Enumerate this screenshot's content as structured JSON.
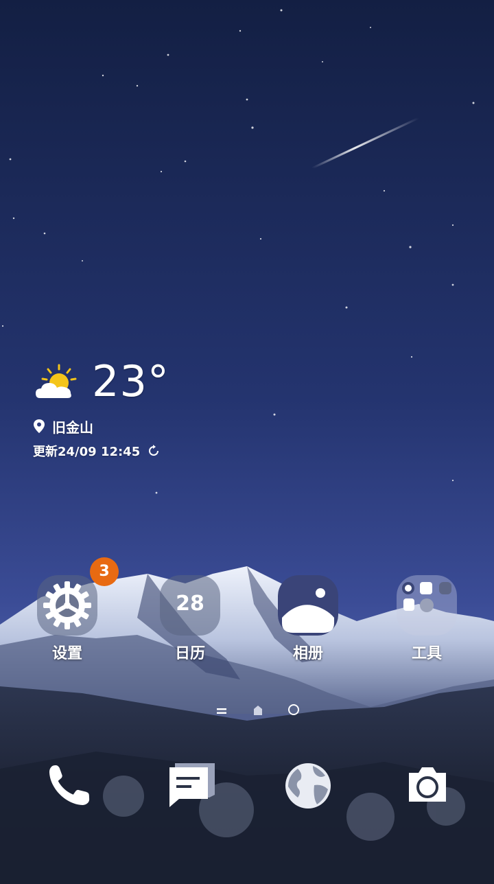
{
  "weather": {
    "temperature": "23°",
    "location": "旧金山",
    "updated": "更新24/09 12:45",
    "icon": "partly-sunny-icon"
  },
  "apps": [
    {
      "label": "设置",
      "icon": "settings-gear-icon",
      "badge": "3"
    },
    {
      "label": "日历",
      "icon": "calendar-icon",
      "date": "28"
    },
    {
      "label": "相册",
      "icon": "gallery-icon"
    },
    {
      "label": "工具",
      "icon": "tools-folder-icon"
    }
  ],
  "dock": [
    {
      "icon": "phone-icon"
    },
    {
      "icon": "messages-icon"
    },
    {
      "icon": "browser-globe-icon"
    },
    {
      "icon": "camera-icon"
    }
  ],
  "page_indicator": {
    "pages": 3,
    "current": 2
  },
  "colors": {
    "badge": "#e86a12",
    "sky_top": "#142347",
    "sky_bottom": "#3d4f9a"
  }
}
